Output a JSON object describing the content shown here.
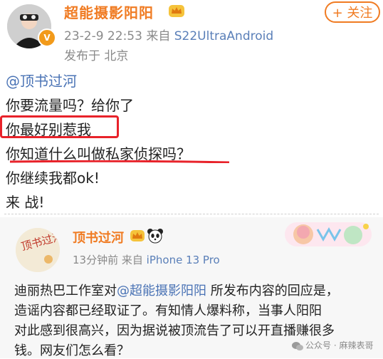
{
  "post": {
    "author": "超能摄影阳阳",
    "follow_label": "+ 关注",
    "date": "23-2-9 22:53",
    "from_prefix": "来自",
    "source": "S22UltraAndroid",
    "location": "发布于 北京",
    "verified_badge": "V",
    "lines": {
      "mention": "@顶书过河",
      "l1": "你要流量吗？给你了",
      "l2": "你最好别惹我",
      "l3": "你知道什么叫做私家侦探吗？",
      "l4": "你继续我都ok!",
      "l5": "来 战!"
    }
  },
  "repost": {
    "author": "顶书过河",
    "time": "13分钟前",
    "from_prefix": "来自",
    "source": "iPhone 13 Pro",
    "text": {
      "r1_pre": "迪丽热巴工作室对",
      "r1_mention": "@超能摄影阳阳",
      "r1_post": " 所发布内容的回应是，",
      "r2": "造谣内容都已经取证了。有知情人爆料称，当事人阳阳",
      "r3": "对此感到很高兴，因为据说被顶流告了可以开直播赚很多",
      "r4": "钱。网友们怎么看？"
    },
    "avatar_text": "顶书过河"
  },
  "watermark": "公众号 · 麻辣表哥",
  "colors": {
    "accent": "#f07b22",
    "link": "#4a73b5",
    "highlight": "#e8222a"
  }
}
